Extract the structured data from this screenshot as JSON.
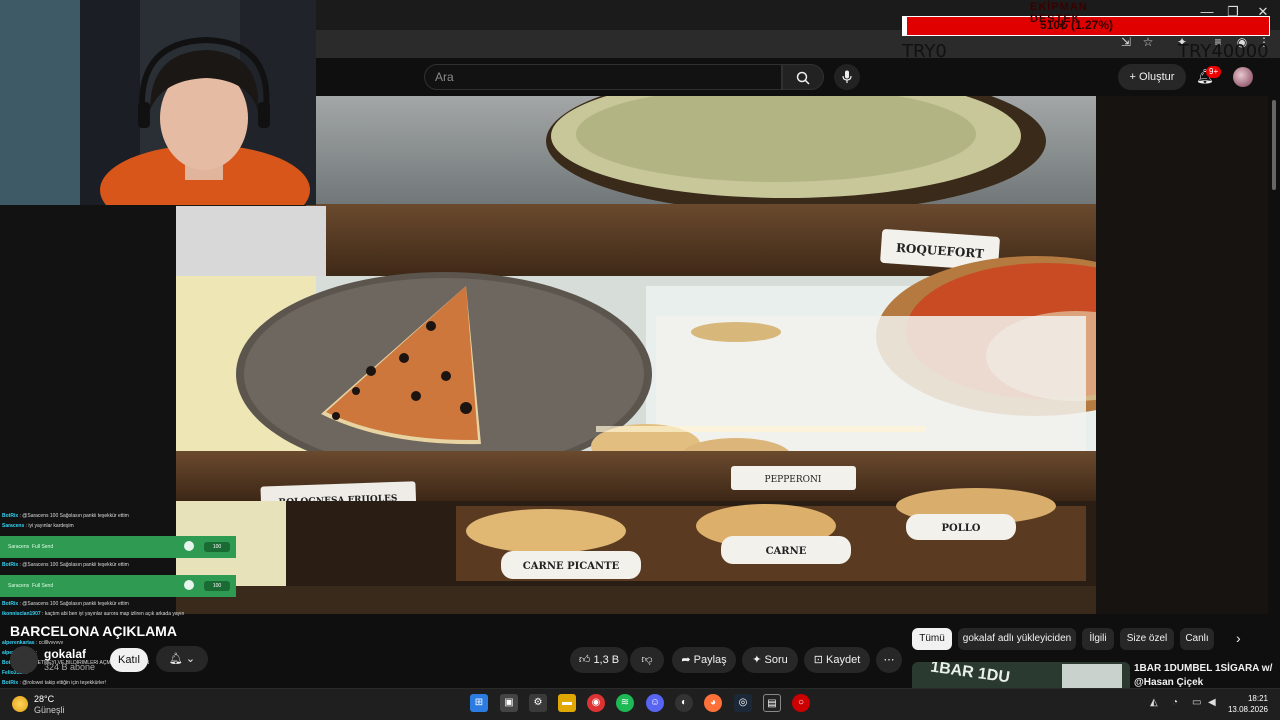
{
  "donation": {
    "title": "EKİPMAN DESTEK",
    "value": "510₺ (1.27%)",
    "progress_percent": 1.27,
    "min_label": "TRY0",
    "max_label": "TRY40000"
  },
  "youtube": {
    "search_placeholder": "Ara",
    "create_label": "+ Oluştur",
    "notifications_badge": "9+"
  },
  "video": {
    "title": "BARCELONA AÇIKLAMA",
    "channel": "gokalaf",
    "subscribers": "324 B abone",
    "join_label": "Katıl",
    "like_count": "1,3 B",
    "share_label": "Paylaş",
    "ask_label": "Soru",
    "save_label": "Kaydet",
    "sign_roquefort": "ROQUEFORT",
    "sign_bolognesa": "BOLOGNESA FRIJOLES",
    "sign_pepperoni": "PEPPERONI",
    "sign_carne_picante": "CARNE PICANTE",
    "sign_carne": "CARNE",
    "sign_pollo": "POLLO"
  },
  "chips": [
    "Tümü",
    "gokalaf adlı yükleyiciden",
    "İlgili",
    "Size özel",
    "Canlı"
  ],
  "recommendation": {
    "title_line1": "1BAR 1DUMBEL 1SİGARA w/",
    "title_line2": "@Hasan Çiçek",
    "thumb_text": "1BAR 1DU"
  },
  "chat": [
    {
      "user": "BotRix",
      "text": "@Saracens 100 Sağolasın pankii teşekkür ettim"
    },
    {
      "user": "Saracens",
      "text": "iyi yayınlar kardeşim"
    },
    {
      "user": "BotRix",
      "text": "@Saracens 100 Sağolasın pankii teşekkür ettim"
    },
    {
      "user": "BotRix",
      "text": "@Saracens 100 Sağolasın pankii teşekkür ettim"
    },
    {
      "user": "ikonnisclan1907",
      "text": "kaçtım abi ben iyi yayınlar aurora map izliren açık arkada yayın"
    },
    {
      "user": "alperenkartas",
      "text": "ccilllvvvvvv"
    },
    {
      "user": "alperenkartas",
      "text": ""
    },
    {
      "user": "BotRix",
      "text": "TAKİP ETMEYİ VE BİLDİRİMLERİ AÇMAYI UNUTMAYIN"
    },
    {
      "user": "Felio3321",
      "text": ""
    },
    {
      "user": "BotRix",
      "text": "@rolowei takip ettiğin için teşekkürler!"
    }
  ],
  "chat_alerts": [
    {
      "user": "Saracens",
      "text": "Full Send",
      "amount": "100"
    },
    {
      "user": "Saracens",
      "text": "Full Send",
      "amount": "100"
    }
  ],
  "taskbar": {
    "temp": "28°C",
    "weather": "Güneşli",
    "time": "18:21",
    "date": "13.08.2026"
  },
  "colors": {
    "youtube_bg": "#0f0f0f",
    "donation_bar": "#e00000",
    "chat_alert": "#2e9a52"
  }
}
